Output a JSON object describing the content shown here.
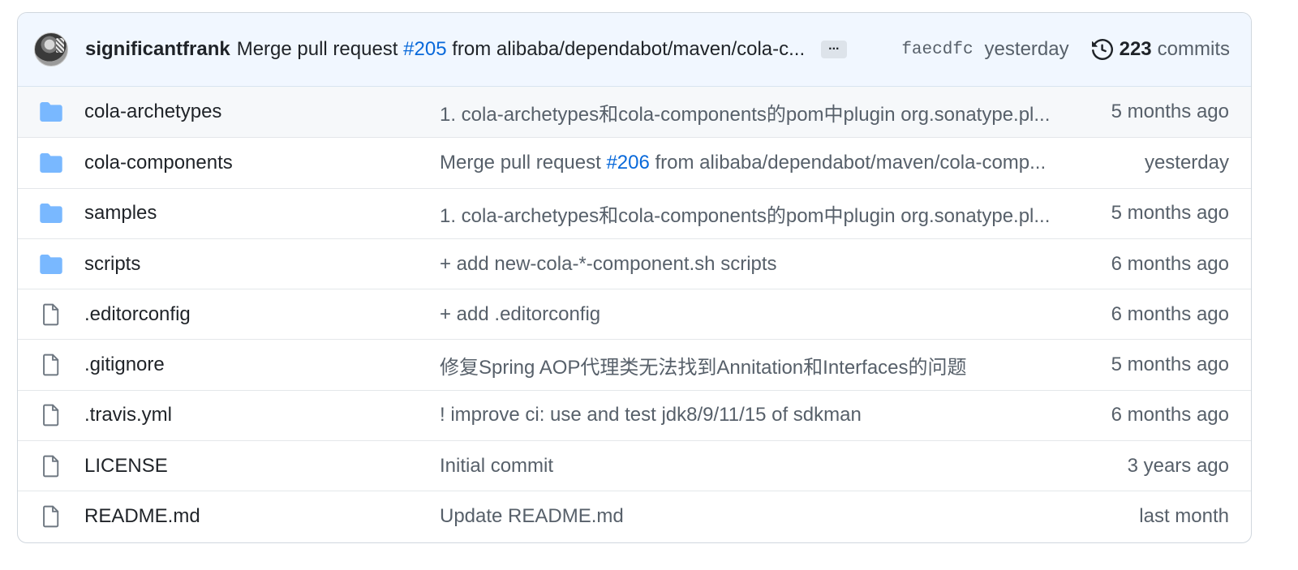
{
  "latest_commit": {
    "author": "significantfrank",
    "message_prefix": "Merge pull request ",
    "pr_link": "#205",
    "message_suffix": " from alibaba/dependabot/maven/cola-c...",
    "ellipsis_label": "...",
    "sha": "faecdfc",
    "when": "yesterday",
    "commit_count": "223",
    "commit_label": "commits"
  },
  "files": [
    {
      "type": "folder",
      "name": "cola-archetypes",
      "message": "1. cola-archetypes和cola-components的pom中plugin org.sonatype.pl...",
      "link": "",
      "message_after": "",
      "age": "5 months ago"
    },
    {
      "type": "folder",
      "name": "cola-components",
      "message": "Merge pull request ",
      "link": "#206",
      "message_after": " from alibaba/dependabot/maven/cola-comp...",
      "age": "yesterday"
    },
    {
      "type": "folder",
      "name": "samples",
      "message": "1. cola-archetypes和cola-components的pom中plugin org.sonatype.pl...",
      "link": "",
      "message_after": "",
      "age": "5 months ago"
    },
    {
      "type": "folder",
      "name": "scripts",
      "message": "+ add new-cola-*-component.sh scripts",
      "link": "",
      "message_after": "",
      "age": "6 months ago"
    },
    {
      "type": "file",
      "name": ".editorconfig",
      "message": "+ add .editorconfig",
      "link": "",
      "message_after": "",
      "age": "6 months ago"
    },
    {
      "type": "file",
      "name": ".gitignore",
      "message": "修复Spring AOP代理类无法找到Annitation和Interfaces的问题",
      "link": "",
      "message_after": "",
      "age": "5 months ago"
    },
    {
      "type": "file",
      "name": ".travis.yml",
      "message": "! improve ci: use and test jdk8/9/11/15 of sdkman",
      "link": "",
      "message_after": "",
      "age": "6 months ago"
    },
    {
      "type": "file",
      "name": "LICENSE",
      "message": "Initial commit",
      "link": "",
      "message_after": "",
      "age": "3 years ago"
    },
    {
      "type": "file",
      "name": "README.md",
      "message": "Update README.md",
      "link": "",
      "message_after": "",
      "age": "last month"
    }
  ],
  "colors": {
    "folder": "#79b8ff",
    "link": "#0969da",
    "muted": "#57606a"
  }
}
